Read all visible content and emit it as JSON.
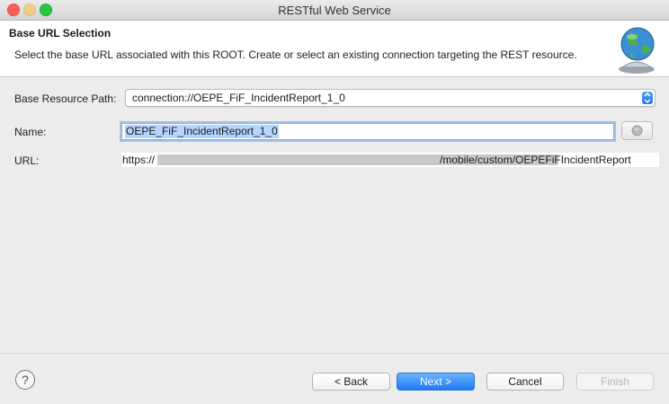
{
  "window": {
    "title": "RESTful Web Service"
  },
  "header": {
    "title": "Base URL Selection",
    "description": "Select the base URL associated with this ROOT.  Create or select an existing connection targeting the REST resource.",
    "icon": "globe-icon"
  },
  "form": {
    "base_path_label": "Base Resource Path:",
    "base_path_value": "connection://OEPE_FiF_IncidentReport_1_0",
    "name_label": "Name:",
    "name_value": "OEPE_FiF_IncidentReport_1_0",
    "url_label": "URL:",
    "url_prefix": "https://",
    "url_suffix": "/mobile/custom/OEPEFiFIncidentReport"
  },
  "buttons": {
    "help": "?",
    "back": "< Back",
    "next": "Next >",
    "cancel": "Cancel",
    "finish": "Finish"
  },
  "colors": {
    "accent": "#1e7af3",
    "header_bg": "#ffffff",
    "dialog_bg": "#ececec"
  }
}
